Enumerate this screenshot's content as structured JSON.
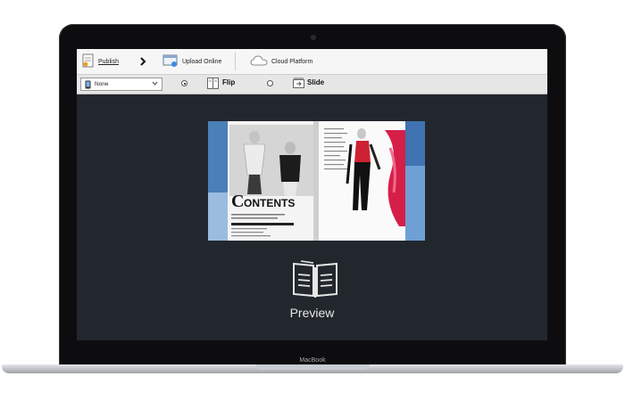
{
  "device": {
    "brand_label": "MacBook"
  },
  "toolbar": {
    "publish_label": "Publish",
    "upload_label": "Upload Online",
    "cloud_label": "Cloud Platform"
  },
  "options": {
    "template_select": {
      "value": "None"
    },
    "flip_label": "Flip",
    "slide_label": "Slide",
    "selected_mode": "Flip"
  },
  "book_preview": {
    "contents_title": "CONTENTS"
  },
  "preview": {
    "label": "Preview"
  },
  "colors": {
    "screen_bg": "#22272d",
    "toolbar_bg": "#f6f6f6",
    "toolbar2_bg": "#e6e6e6",
    "preview_text": "#e6e6e6"
  },
  "icons": [
    "publish-icon",
    "chevron-right-icon",
    "upload-online-icon",
    "cloud-icon",
    "tablet-icon",
    "chevron-down-icon",
    "flip-icon",
    "slide-icon",
    "book-preview-icon"
  ]
}
